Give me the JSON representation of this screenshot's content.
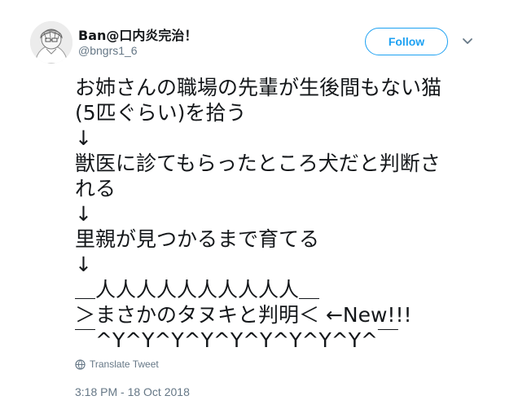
{
  "tweet": {
    "display_name": "Ban@口内炎完治！",
    "handle": "@bngrs1_6",
    "follow_label": "Follow",
    "lines": [
      "お姉さんの職場の先輩が生後間もない猫",
      "(5匹ぐらい)を拾う",
      "↓",
      "獣医に診てもらったところ犬だと判断さ",
      "れる",
      "↓",
      "里親が見つかるまで育てる",
      "↓",
      "＿人人人人人人人人人人＿",
      "＞まさかのタヌキと判明＜ ←New!!!",
      "￣^Y^Y^Y^Y^Y^Y^Y^Y^Y^￣"
    ],
    "translate_label": "Translate Tweet",
    "timestamp": "3:18 PM - 18 Oct 2018"
  },
  "icons": {
    "menu": "chevron-down-icon",
    "translate": "globe-icon",
    "avatar": "avatar-illustration"
  },
  "colors": {
    "accent": "#1da1f2",
    "secondary_text": "#657786",
    "primary_text": "#14171a"
  }
}
